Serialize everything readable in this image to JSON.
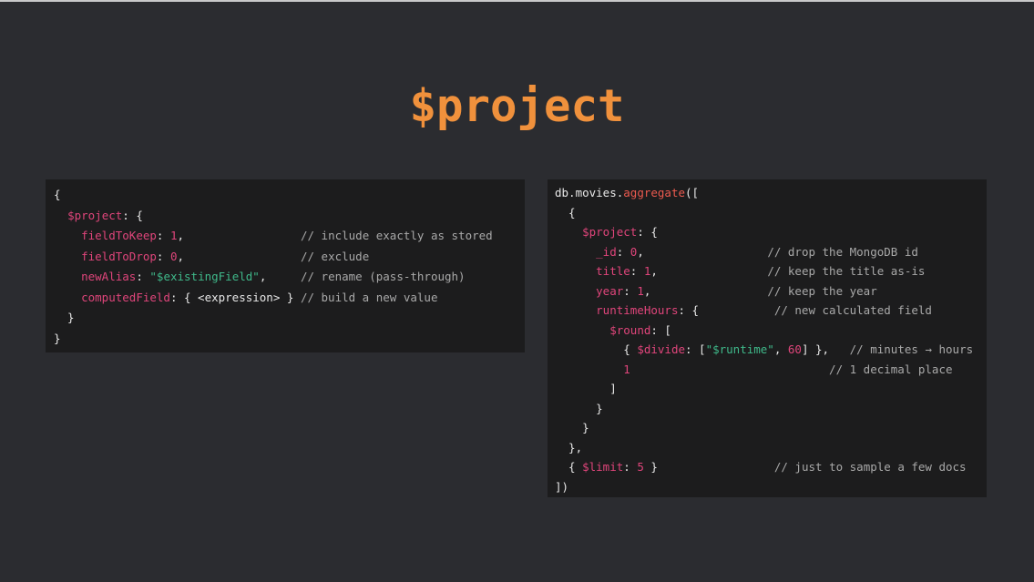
{
  "slide": {
    "title": "$project"
  },
  "colors": {
    "background": "#2b2c30",
    "panel": "#1c1c1d",
    "title": "#f0913c",
    "key": "#e0457b",
    "string": "#3fb98a",
    "comment": "#a9a9a9",
    "function": "#ec5a4f",
    "plain": "#e8e8e8"
  },
  "left_code": {
    "lines": [
      [
        {
          "t": "{",
          "c": "plain"
        }
      ],
      [
        {
          "t": "  ",
          "c": "plain"
        },
        {
          "t": "$project",
          "c": "key"
        },
        {
          "t": ": {",
          "c": "plain"
        }
      ],
      [
        {
          "t": "    ",
          "c": "plain"
        },
        {
          "t": "fieldToKeep",
          "c": "key"
        },
        {
          "t": ": ",
          "c": "plain"
        },
        {
          "t": "1",
          "c": "num"
        },
        {
          "t": ",                 ",
          "c": "plain"
        },
        {
          "t": "// include exactly as stored",
          "c": "comment"
        }
      ],
      [
        {
          "t": "    ",
          "c": "plain"
        },
        {
          "t": "fieldToDrop",
          "c": "key"
        },
        {
          "t": ": ",
          "c": "plain"
        },
        {
          "t": "0",
          "c": "num"
        },
        {
          "t": ",                 ",
          "c": "plain"
        },
        {
          "t": "// exclude",
          "c": "comment"
        }
      ],
      [
        {
          "t": "    ",
          "c": "plain"
        },
        {
          "t": "newAlias",
          "c": "key"
        },
        {
          "t": ": ",
          "c": "plain"
        },
        {
          "t": "\"$existingField\"",
          "c": "str"
        },
        {
          "t": ",     ",
          "c": "plain"
        },
        {
          "t": "// rename (pass-through)",
          "c": "comment"
        }
      ],
      [
        {
          "t": "    ",
          "c": "plain"
        },
        {
          "t": "computedField",
          "c": "key"
        },
        {
          "t": ": { <expression> } ",
          "c": "plain"
        },
        {
          "t": "// build a new value",
          "c": "comment"
        }
      ],
      [
        {
          "t": "  }",
          "c": "plain"
        }
      ],
      [
        {
          "t": "}",
          "c": "plain"
        }
      ]
    ]
  },
  "right_code": {
    "lines": [
      [
        {
          "t": "db.movies.",
          "c": "plain"
        },
        {
          "t": "aggregate",
          "c": "fn"
        },
        {
          "t": "([",
          "c": "plain"
        }
      ],
      [
        {
          "t": "  {",
          "c": "plain"
        }
      ],
      [
        {
          "t": "    ",
          "c": "plain"
        },
        {
          "t": "$project",
          "c": "key"
        },
        {
          "t": ": {",
          "c": "plain"
        }
      ],
      [
        {
          "t": "      ",
          "c": "plain"
        },
        {
          "t": "_id",
          "c": "key"
        },
        {
          "t": ": ",
          "c": "plain"
        },
        {
          "t": "0",
          "c": "num"
        },
        {
          "t": ",                  ",
          "c": "plain"
        },
        {
          "t": "// drop the MongoDB id",
          "c": "comment"
        }
      ],
      [
        {
          "t": "      ",
          "c": "plain"
        },
        {
          "t": "title",
          "c": "key"
        },
        {
          "t": ": ",
          "c": "plain"
        },
        {
          "t": "1",
          "c": "num"
        },
        {
          "t": ",                ",
          "c": "plain"
        },
        {
          "t": "// keep the title as-is",
          "c": "comment"
        }
      ],
      [
        {
          "t": "      ",
          "c": "plain"
        },
        {
          "t": "year",
          "c": "key"
        },
        {
          "t": ": ",
          "c": "plain"
        },
        {
          "t": "1",
          "c": "num"
        },
        {
          "t": ",                 ",
          "c": "plain"
        },
        {
          "t": "// keep the year",
          "c": "comment"
        }
      ],
      [
        {
          "t": "      ",
          "c": "plain"
        },
        {
          "t": "runtimeHours",
          "c": "key"
        },
        {
          "t": ": {           ",
          "c": "plain"
        },
        {
          "t": "// new calculated field",
          "c": "comment"
        }
      ],
      [
        {
          "t": "        ",
          "c": "plain"
        },
        {
          "t": "$round",
          "c": "key"
        },
        {
          "t": ": [",
          "c": "plain"
        }
      ],
      [
        {
          "t": "          { ",
          "c": "plain"
        },
        {
          "t": "$divide",
          "c": "key"
        },
        {
          "t": ": [",
          "c": "plain"
        },
        {
          "t": "\"$runtime\"",
          "c": "str"
        },
        {
          "t": ", ",
          "c": "plain"
        },
        {
          "t": "60",
          "c": "num"
        },
        {
          "t": "] },   ",
          "c": "plain"
        },
        {
          "t": "// minutes → hours",
          "c": "comment"
        }
      ],
      [
        {
          "t": "          ",
          "c": "plain"
        },
        {
          "t": "1",
          "c": "num"
        },
        {
          "t": "                             ",
          "c": "plain"
        },
        {
          "t": "// 1 decimal place",
          "c": "comment"
        }
      ],
      [
        {
          "t": "        ]",
          "c": "plain"
        }
      ],
      [
        {
          "t": "      }",
          "c": "plain"
        }
      ],
      [
        {
          "t": "    }",
          "c": "plain"
        }
      ],
      [
        {
          "t": "  },",
          "c": "plain"
        }
      ],
      [
        {
          "t": "  { ",
          "c": "plain"
        },
        {
          "t": "$limit",
          "c": "key"
        },
        {
          "t": ": ",
          "c": "plain"
        },
        {
          "t": "5",
          "c": "num"
        },
        {
          "t": " }                 ",
          "c": "plain"
        },
        {
          "t": "// just to sample a few docs",
          "c": "comment"
        }
      ],
      [
        {
          "t": "])",
          "c": "plain"
        }
      ]
    ]
  }
}
